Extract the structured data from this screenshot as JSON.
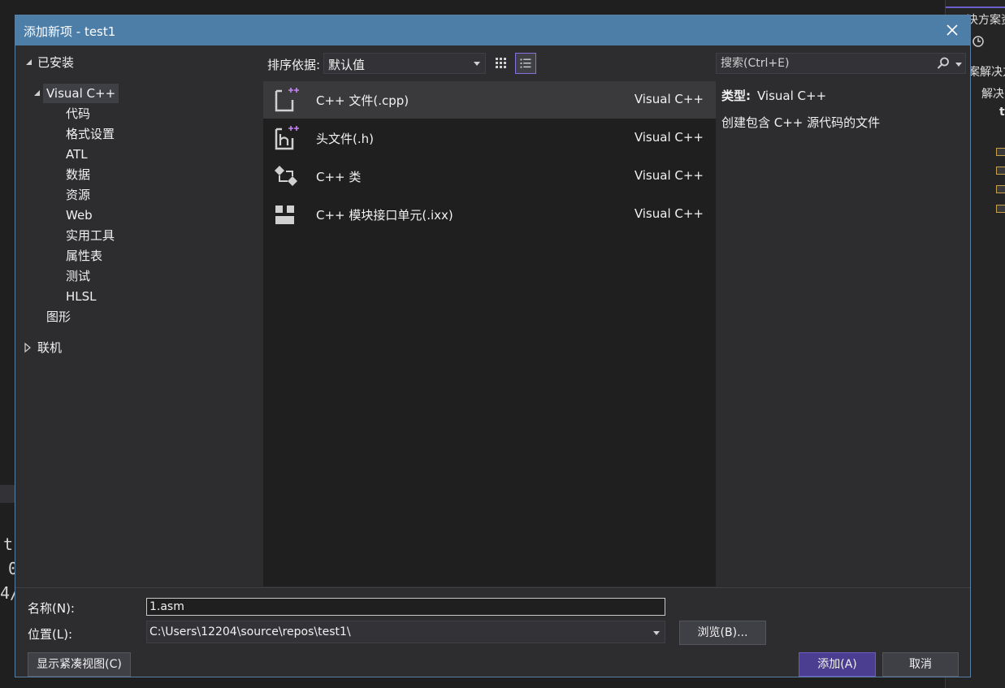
{
  "background": {
    "right_title": "决方案资",
    "right_rows": [
      "案解决方",
      "解决",
      "t"
    ],
    "left_chars": [
      "t",
      "0",
      "4/"
    ]
  },
  "dialog": {
    "title": "添加新项 - test1",
    "close_icon": "close-icon"
  },
  "tree": {
    "installed": "已安装",
    "visual_cpp": "Visual C++",
    "children": [
      "代码",
      "格式设置",
      "ATL",
      "数据",
      "资源",
      "Web",
      "实用工具",
      "属性表",
      "测试",
      "HLSL"
    ],
    "graphics": "图形",
    "online": "联机"
  },
  "toolbar": {
    "sort_label": "排序依据:",
    "sort_value": "默认值",
    "search_placeholder": "搜索(Ctrl+E)"
  },
  "templates": [
    {
      "name": "C++ 文件(.cpp)",
      "lang": "Visual C++",
      "icon": "cpp-file-icon"
    },
    {
      "name": "头文件(.h)",
      "lang": "Visual C++",
      "icon": "header-file-icon"
    },
    {
      "name": "C++ 类",
      "lang": "Visual C++",
      "icon": "cpp-class-icon"
    },
    {
      "name": "C++ 模块接口单元(.ixx)",
      "lang": "Visual C++",
      "icon": "module-unit-icon"
    }
  ],
  "details": {
    "type_label": "类型:",
    "type_value": "Visual C++",
    "description": "创建包含 C++ 源代码的文件"
  },
  "form": {
    "name_label": "名称(N):",
    "name_value": "1.asm",
    "location_label": "位置(L):",
    "location_value": "C:\\Users\\12204\\source\\repos\\test1\\",
    "browse_label": "浏览(B)...",
    "compact_label": "显示紧凑视图(C)",
    "add_label": "添加(A)",
    "cancel_label": "取消"
  },
  "colors": {
    "titlebar": "#4d7ea8",
    "accent": "#8a6fe0",
    "primary_button": "#4b3d8f"
  }
}
